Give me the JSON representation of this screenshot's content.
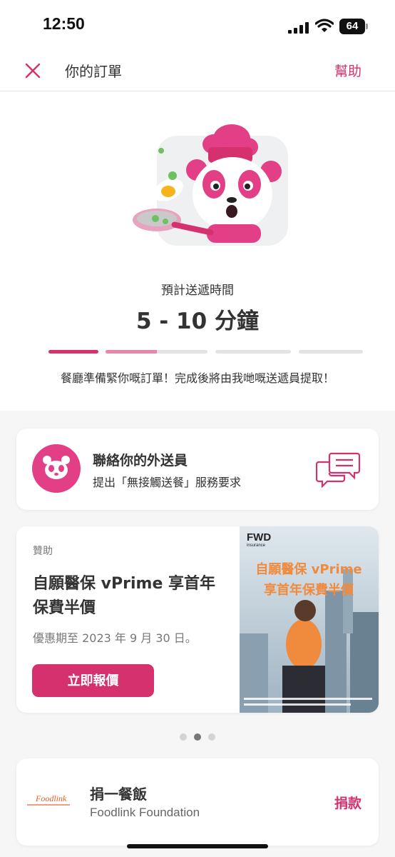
{
  "status_bar": {
    "time": "12:50",
    "battery": "64"
  },
  "nav": {
    "title": "你的訂單",
    "help_label": "幫助"
  },
  "eta": {
    "label": "預計送遞時間",
    "value": "5 - 10 分鐘",
    "progress": [
      1.0,
      0.5,
      0.0,
      0.0
    ],
    "message": "餐廳準備緊你嘅訂單！完成後將由我哋嘅送遞員提取！"
  },
  "contact": {
    "title": "聯絡你的外送員",
    "subtitle": "提出「無接觸送餐」服務要求"
  },
  "ad": {
    "tag": "贊助",
    "title": "自願醫保 vPrime 享首年保費半價",
    "period": "優惠期至 2023 年 9 月 30 日。",
    "cta": "立即報價",
    "image_brand": "FWD",
    "image_brand_sub": "insurance",
    "image_headline_1": "自願醫保 vPrime",
    "image_headline_2": "享首年保費半價"
  },
  "carousel": {
    "count": 3,
    "active_index": 1
  },
  "donate": {
    "logo_text": "Foodlink",
    "title": "捐一餐飯",
    "subtitle": "Foodlink Foundation",
    "cta": "捐款"
  },
  "colors": {
    "brand": "#d5316f",
    "panda": "#e23f86",
    "progress_inactive": "#e3e3e3"
  }
}
